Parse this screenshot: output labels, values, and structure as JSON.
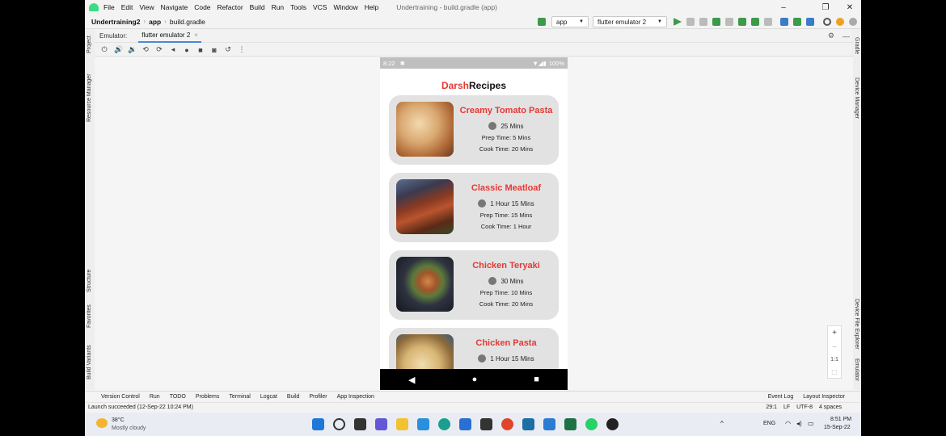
{
  "menubar": {
    "items": [
      "File",
      "Edit",
      "View",
      "Navigate",
      "Code",
      "Refactor",
      "Build",
      "Run",
      "Tools",
      "VCS",
      "Window",
      "Help"
    ],
    "window_title": "Undertraining - build.gradle (app)"
  },
  "toolbar": {
    "project": "Undertraining2",
    "module": "app",
    "file": "build.gradle",
    "run_config": "app",
    "device": "flutter emulator 2"
  },
  "emulator": {
    "label": "Emulator:",
    "tab": "flutter emulator 2"
  },
  "left_strip": {
    "project": "Project",
    "resource_manager": "Resource Manager",
    "structure": "Structure",
    "favorites": "Favorites",
    "build_variants": "Build Variants"
  },
  "right_strip": {
    "gradle": "Gradle",
    "device_manager": "Device Manager",
    "device_file_explorer": "Device File Explorer",
    "emulator": "Emulator"
  },
  "phone": {
    "status_time": "8:22",
    "battery": "100%",
    "title_brand": "Darsh",
    "title_rest": "Recipes",
    "recipes": [
      {
        "name": "Creamy Tomato Pasta",
        "total": "25 Mins",
        "prep": "Prep Time: 5 Mins",
        "cook": "Cook Time: 20 Mins"
      },
      {
        "name": "Classic Meatloaf",
        "total": "1 Hour 15 Mins",
        "prep": "Prep Time: 15 Mins",
        "cook": "Cook Time: 1 Hour"
      },
      {
        "name": "Chicken Teryaki",
        "total": "30 Mins",
        "prep": "Prep Time: 10 Mins",
        "cook": "Cook Time: 20 Mins"
      },
      {
        "name": "Chicken Pasta",
        "total": "1 Hour 15 Mins",
        "prep": "",
        "cook": ""
      }
    ]
  },
  "zoom": {
    "plus": "+",
    "minus": "−",
    "ratio": "1:1"
  },
  "toolwindows": [
    "Version Control",
    "Run",
    "TODO",
    "Problems",
    "Terminal",
    "Logcat",
    "Build",
    "Profiler",
    "App Inspection"
  ],
  "toolwindows_right": [
    "Event Log",
    "Layout Inspector"
  ],
  "statusbar": {
    "message": "Launch succeeded (12-Sep-22 10:24 PM)",
    "position": "29:1",
    "line_sep": "LF",
    "encoding": "UTF-8",
    "indent": "4 spaces"
  },
  "taskbar": {
    "temp": "38°C",
    "weather": "Mostly cloudy",
    "lang": "ENG",
    "time": "8:51 PM",
    "date": "15-Sep-22"
  }
}
